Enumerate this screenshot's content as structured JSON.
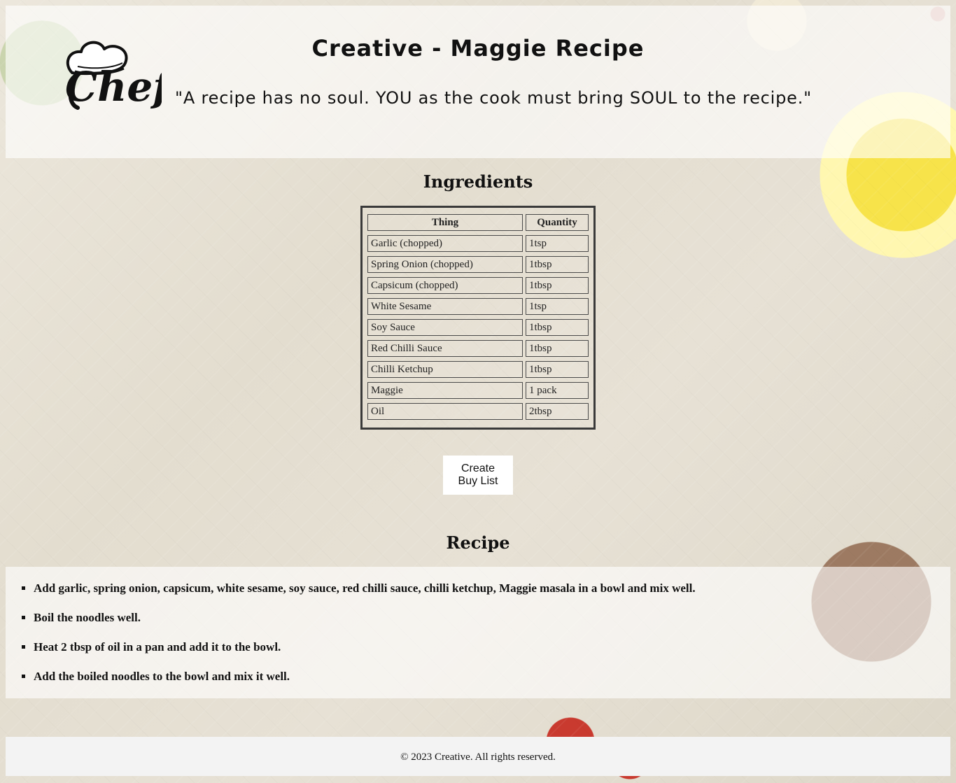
{
  "header": {
    "logo_text": "Chef",
    "title": "Creative - Maggie Recipe",
    "quote": "\"A recipe has no soul. YOU as the cook must bring SOUL to the recipe.\""
  },
  "ingredients": {
    "heading": "Ingredients",
    "columns": [
      "Thing",
      "Quantity"
    ],
    "rows": [
      [
        "Garlic (chopped)",
        "1tsp"
      ],
      [
        "Spring Onion (chopped)",
        "1tbsp"
      ],
      [
        "Capsicum (chopped)",
        "1tbsp"
      ],
      [
        "White Sesame",
        "1tsp"
      ],
      [
        "Soy Sauce",
        "1tbsp"
      ],
      [
        "Red Chilli Sauce",
        "1tbsp"
      ],
      [
        "Chilli Ketchup",
        "1tbsp"
      ],
      [
        "Maggie",
        "1 pack"
      ],
      [
        "Oil",
        "2tbsp"
      ]
    ]
  },
  "actions": {
    "buy_list_label": "Create Buy List"
  },
  "recipe": {
    "heading": "Recipe",
    "steps": [
      "Add garlic, spring onion, capsicum, white sesame, soy sauce, red chilli sauce, chilli ketchup, Maggie masala in a bowl and mix well.",
      "Boil the noodles well.",
      "Heat 2 tbsp of oil in a pan and add it to the bowl.",
      "Add the boiled noodles to the bowl and mix it well."
    ]
  },
  "footer": {
    "text": "© 2023 Creative. All rights reserved."
  },
  "colors": {
    "panel": "#ffffff",
    "text": "#111111",
    "footer_bg": "#f3f3f3"
  }
}
